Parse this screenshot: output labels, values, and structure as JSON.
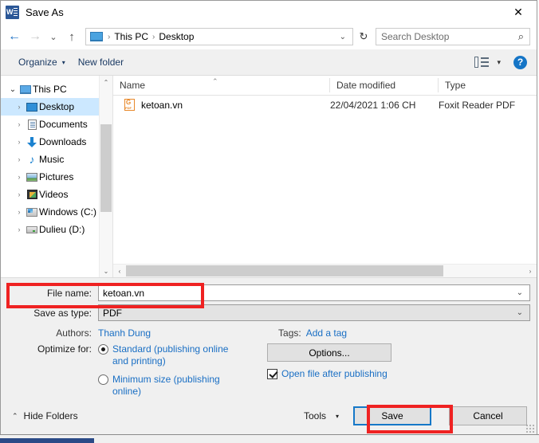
{
  "window": {
    "title": "Save As",
    "app_icon": "word-icon",
    "close_label": "✕"
  },
  "nav": {
    "back_icon": "←",
    "forward_icon": "→",
    "recent_icon": "⌄",
    "up_icon": "↑",
    "refresh_icon": "↻",
    "breadcrumbs": [
      "This PC",
      "Desktop"
    ],
    "breadcrumb_separator": "›",
    "address_caret": "⌄"
  },
  "search": {
    "placeholder": "Search Desktop",
    "value": "",
    "icon": "⌕"
  },
  "commandbar": {
    "organize_label": "Organize",
    "organize_caret": "▾",
    "new_folder_label": "New folder",
    "view_caret": "▾",
    "help_label": "?"
  },
  "sidebar": {
    "items": [
      {
        "label": "This PC",
        "icon": "pc-icon",
        "expander": "⌄",
        "level": 1,
        "selected": false,
        "expanded": true
      },
      {
        "label": "Desktop",
        "icon": "desktop-icon",
        "expander": "›",
        "level": 2,
        "selected": true,
        "expanded": false
      },
      {
        "label": "Documents",
        "icon": "documents-icon",
        "expander": "›",
        "level": 2,
        "selected": false,
        "expanded": false
      },
      {
        "label": "Downloads",
        "icon": "downloads-icon",
        "expander": "›",
        "level": 2,
        "selected": false,
        "expanded": false
      },
      {
        "label": "Music",
        "icon": "music-icon",
        "expander": "›",
        "level": 2,
        "selected": false,
        "expanded": false
      },
      {
        "label": "Pictures",
        "icon": "pictures-icon",
        "expander": "›",
        "level": 2,
        "selected": false,
        "expanded": false
      },
      {
        "label": "Videos",
        "icon": "videos-icon",
        "expander": "›",
        "level": 2,
        "selected": false,
        "expanded": false
      },
      {
        "label": "Windows (C:)",
        "icon": "c-drive-icon",
        "expander": "›",
        "level": 2,
        "selected": false,
        "expanded": false
      },
      {
        "label": "Dulieu (D:)",
        "icon": "d-drive-icon",
        "expander": "›",
        "level": 2,
        "selected": false,
        "expanded": false
      }
    ],
    "scroll_up_icon": "⌃",
    "scroll_down_icon": "⌄"
  },
  "filelist": {
    "columns": [
      "Name",
      "Date modified",
      "Type"
    ],
    "sort_indicator": "⌃",
    "rows": [
      {
        "name": "ketoan.vn",
        "icon": "pdf-file-icon",
        "date_modified": "22/04/2021 1:06 CH",
        "type": "Foxit Reader PDF"
      }
    ],
    "hscroll_left_icon": "‹",
    "hscroll_right_icon": "›"
  },
  "form": {
    "file_name_label": "File name:",
    "file_name_value": "ketoan.vn",
    "save_as_type_label": "Save as type:",
    "save_as_type_value": "PDF",
    "combo_caret": "⌄",
    "authors_label": "Authors:",
    "authors_value": "Thanh Dung",
    "tags_label": "Tags:",
    "tags_value": "Add a tag",
    "optimize_label": "Optimize for:",
    "radio_standard": "Standard (publishing online and printing)",
    "radio_minimum": "Minimum size (publishing online)",
    "radio_selected": "standard",
    "options_button": "Options...",
    "open_after_label": "Open file after publishing",
    "open_after_checked": true
  },
  "footer": {
    "hide_folders_label": "Hide Folders",
    "hide_folders_caret": "⌃",
    "tools_label": "Tools",
    "tools_caret": "▾",
    "save_label": "Save",
    "cancel_label": "Cancel"
  },
  "annotations": {
    "color": "#ef2222",
    "highlights": [
      "save-as-type-row",
      "save-button"
    ]
  }
}
